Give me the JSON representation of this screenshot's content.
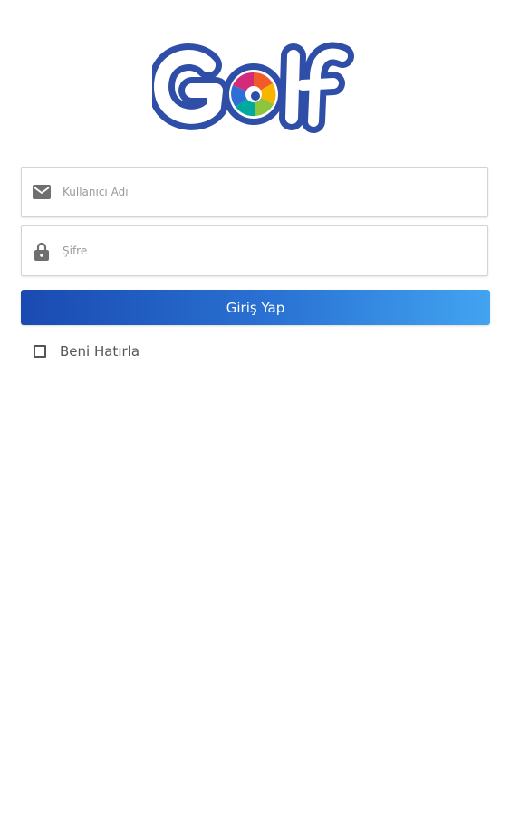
{
  "app": {
    "logo_text": "Golf",
    "brand_color": "#2f4ea8"
  },
  "login_form": {
    "username": {
      "icon": "mail-icon",
      "placeholder": "Kullanıcı Adı",
      "value": ""
    },
    "password": {
      "icon": "lock-icon",
      "placeholder": "Şifre",
      "value": ""
    },
    "submit_label": "Giriş Yap",
    "submit_gradient": [
      "#1a4ab1",
      "#42a4f1"
    ],
    "remember_me": {
      "label": "Beni Hatırla",
      "checked": false
    }
  }
}
